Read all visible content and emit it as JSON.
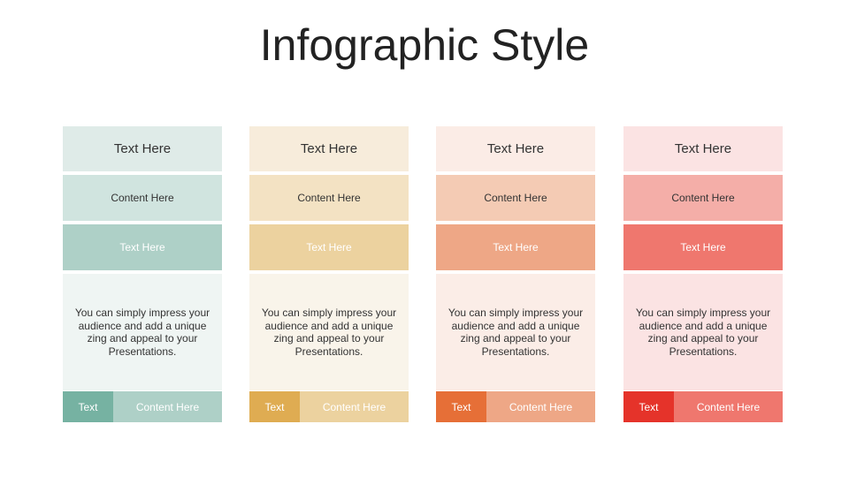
{
  "title": "Infographic Style",
  "columns": [
    {
      "heading": "Text Here",
      "content": "Content Here",
      "subheading": "Text Here",
      "body": "You can simply impress your audience and add a unique zing and appeal to your Presentations.",
      "footer_tab": "Text",
      "footer_label": "Content Here",
      "colors": {
        "r1": "#dfebe8",
        "r2": "#d0e4df",
        "r3": "#aed0c7",
        "r4": "#eff5f3",
        "tab": "#76b2a2",
        "footer": "#aed0c7"
      }
    },
    {
      "heading": "Text Here",
      "content": "Content Here",
      "subheading": "Text Here",
      "body": "You can simply impress your audience and add a unique zing and appeal to your Presentations.",
      "footer_tab": "Text",
      "footer_label": "Content Here",
      "colors": {
        "r1": "#f7ecdb",
        "r2": "#f3e2c3",
        "r3": "#ecd29f",
        "r4": "#f9f4ea",
        "tab": "#dfac52",
        "footer": "#ecd29f"
      }
    },
    {
      "heading": "Text Here",
      "content": "Content Here",
      "subheading": "Text Here",
      "body": "You can simply impress your audience and add a unique zing and appeal to your Presentations.",
      "footer_tab": "Text",
      "footer_label": "Content Here",
      "colors": {
        "r1": "#fbece6",
        "r2": "#f4cbb4",
        "r3": "#eea786",
        "r4": "#fbede7",
        "tab": "#e66f37",
        "footer": "#eea786"
      }
    },
    {
      "heading": "Text Here",
      "content": "Content Here",
      "subheading": "Text Here",
      "body": "You can simply impress your audience and add a unique zing and appeal to your Presentations.",
      "footer_tab": "Text",
      "footer_label": "Content Here",
      "colors": {
        "r1": "#fbe3e3",
        "r2": "#f4aea8",
        "r3": "#ef776e",
        "r4": "#fbe3e3",
        "tab": "#e5332a",
        "footer": "#ef776e"
      }
    }
  ]
}
